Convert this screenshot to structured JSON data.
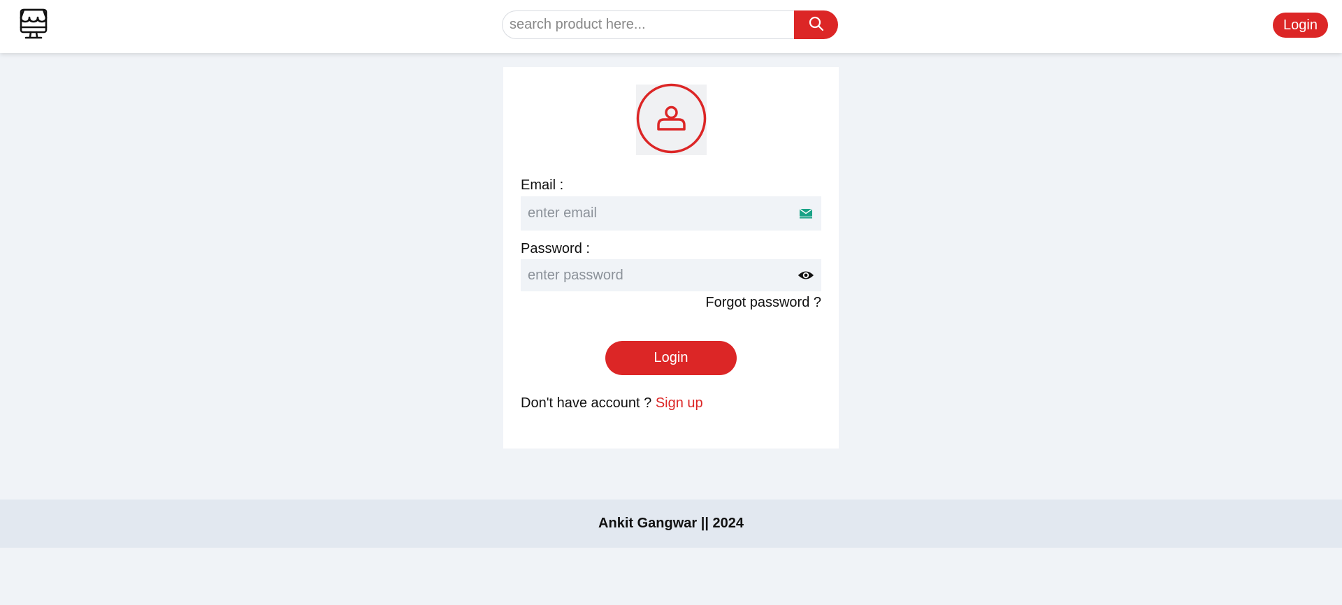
{
  "header": {
    "logo_icon": "shop-monitor-icon",
    "search": {
      "placeholder": "search product here...",
      "value": "",
      "icon": "search-icon"
    },
    "login_label": "Login"
  },
  "login_card": {
    "avatar_icon": "user-circle-icon",
    "email": {
      "label": "Email :",
      "placeholder": "enter email",
      "value": "",
      "icon": "mail-icon"
    },
    "password": {
      "label": "Password :",
      "placeholder": "enter password",
      "value": "",
      "icon": "eye-icon"
    },
    "forgot_label": "Forgot password ?",
    "submit_label": "Login",
    "signup_prompt": "Don't have account ? ",
    "signup_link": "Sign up"
  },
  "footer": {
    "text": "Ankit Gangwar || 2024"
  },
  "colors": {
    "accent": "#dc2626",
    "page_bg": "#f0f3f7",
    "footer_bg": "#e2e8f0",
    "mail_icon": "#16a085"
  }
}
